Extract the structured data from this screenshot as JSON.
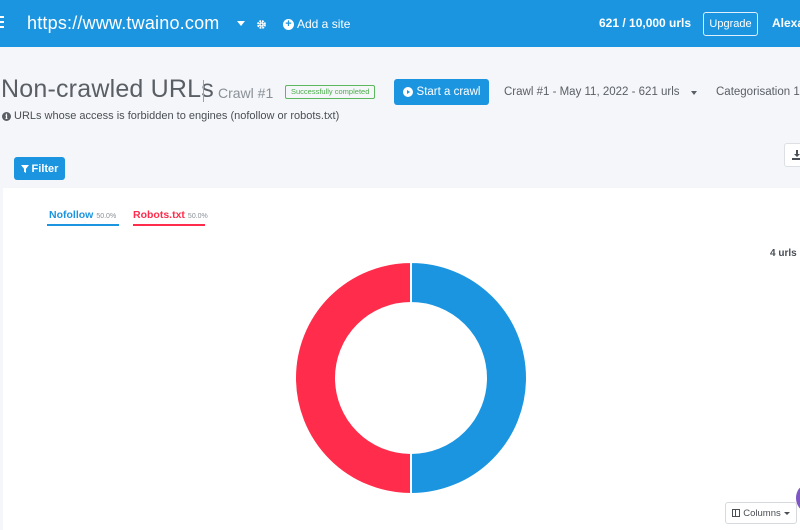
{
  "topbar": {
    "site_url": "https://www.twaino.com",
    "add_site_label": "Add a site",
    "quota": "621 / 10,000 urls",
    "upgrade_label": "Upgrade",
    "user_name": "Alexa"
  },
  "header": {
    "title": "Non-crawled URLs",
    "crawl_label": "Crawl #1",
    "status_badge": "Successfully completed",
    "start_crawl_label": "Start a crawl",
    "crawl_select": "Crawl #1 - May 11, 2022 - 621 urls",
    "categorisation": "Categorisation 1",
    "subtitle": "URLs whose access is forbidden to engines (nofollow or robots.txt)"
  },
  "toolbar": {
    "filter_label": "Filter"
  },
  "chart_panel": {
    "urls_count": "4 urls",
    "columns_label": "Columns"
  },
  "chart_data": {
    "type": "pie",
    "donut": true,
    "categories": [
      "Nofollow",
      "Robots.txt"
    ],
    "values": [
      50.0,
      50.0
    ],
    "value_labels": [
      "50.0%",
      "50.0%"
    ],
    "colors": [
      "#1b95e0",
      "#ff2d4b"
    ],
    "legend_position": "top-left"
  },
  "colors": {
    "primary": "#1b95e0",
    "success": "#5cb85c",
    "nofollow": "#1b95e0",
    "robots": "#ff2d4b"
  },
  "icons": {
    "menu": "menu-icon",
    "gear": "gear-icon",
    "add": "plus-circle-icon",
    "play": "play-circle-icon",
    "info": "info-icon",
    "filter": "filter-icon",
    "download": "download-icon",
    "columns": "columns-icon"
  }
}
